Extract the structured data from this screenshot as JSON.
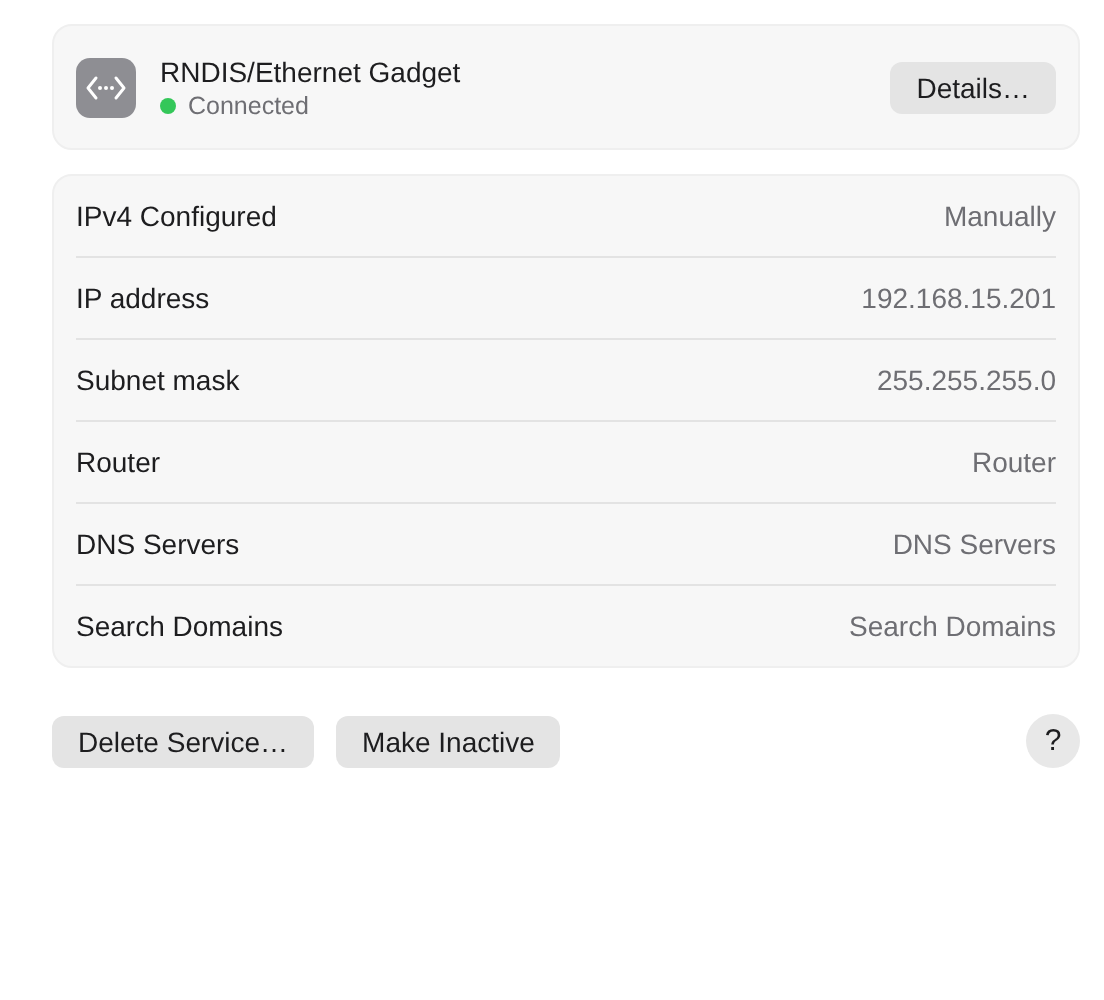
{
  "service": {
    "name": "RNDIS/Ethernet Gadget",
    "status": "Connected",
    "connected": true,
    "details_button": "Details…"
  },
  "settings": [
    {
      "label": "IPv4 Configured",
      "value": "Manually"
    },
    {
      "label": "IP address",
      "value": "192.168.15.201"
    },
    {
      "label": "Subnet mask",
      "value": "255.255.255.0"
    },
    {
      "label": "Router",
      "value": "Router"
    },
    {
      "label": "DNS Servers",
      "value": "DNS Servers"
    },
    {
      "label": "Search Domains",
      "value": "Search Domains"
    }
  ],
  "buttons": [
    "Delete Service…",
    "Make Inactive"
  ],
  "help_button": "?"
}
